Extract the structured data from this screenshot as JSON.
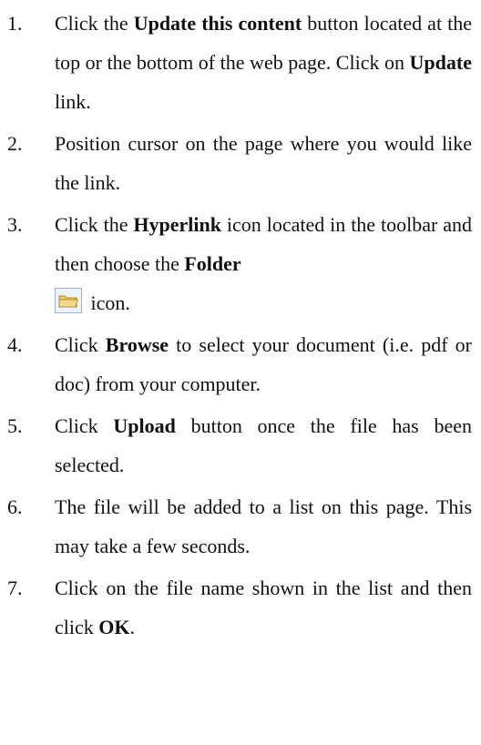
{
  "steps": [
    {
      "number": "1.",
      "parts": [
        "Click the ",
        "Update this content",
        " button located at the top or the bottom of the web page. Click on ",
        "Update",
        " link."
      ]
    },
    {
      "number": "2.",
      "text": "Position cursor on the page where you would like the link."
    },
    {
      "number": "3.",
      "parts": [
        "Click the ",
        "Hyperlink",
        " icon located in the toolbar and then choose the ",
        "Folder",
        " icon."
      ],
      "icon": "folder-icon"
    },
    {
      "number": "4.",
      "parts": [
        "Click ",
        "Browse",
        " to select your document (i.e. pdf or doc) from your computer."
      ]
    },
    {
      "number": "5.",
      "parts": [
        "Click ",
        "Upload",
        " button once the file has been selected."
      ]
    },
    {
      "number": "6.",
      "text": "The file will be added to a list on this page. This may take a few seconds."
    },
    {
      "number": "7.",
      "parts": [
        "Click on the file name shown in the list and then click ",
        "OK",
        "."
      ]
    }
  ]
}
